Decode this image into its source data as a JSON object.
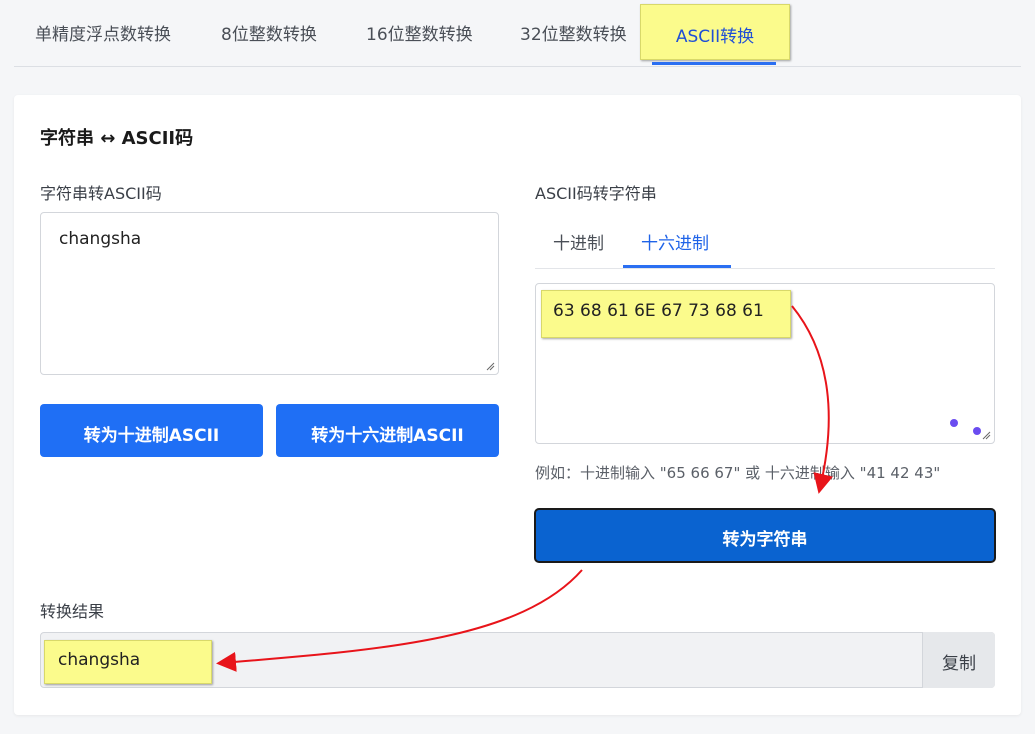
{
  "tabs": {
    "items": [
      "单精度浮点数转换",
      "8位整数转换",
      "16位整数转换",
      "32位整数转换",
      "ASCII转换"
    ],
    "active": "ASCII转换"
  },
  "section": {
    "title": "字符串 ↔ ASCII码"
  },
  "left": {
    "label": "字符串转ASCII码",
    "input_value": "changsha",
    "btn_decimal": "转为十进制ASCII",
    "btn_hex": "转为十六进制ASCII"
  },
  "right": {
    "label": "ASCII码转字符串",
    "subtabs": [
      "十进制",
      "十六进制"
    ],
    "active_subtab": "十六进制",
    "input_value": "63 68 61 6E 67 73 68 61",
    "hint": "例如：十进制输入 \"65 66 67\" 或 十六进制输入 \"41 42 43\"",
    "btn_convert": "转为字符串"
  },
  "result": {
    "label": "转换结果",
    "value": "changsha",
    "copy_label": "复制"
  },
  "colors": {
    "primary": "#1f6ff5",
    "convert_button": "#0a63d0",
    "highlight": "#fbfb8c",
    "annotation_arrow": "#e8141a"
  }
}
